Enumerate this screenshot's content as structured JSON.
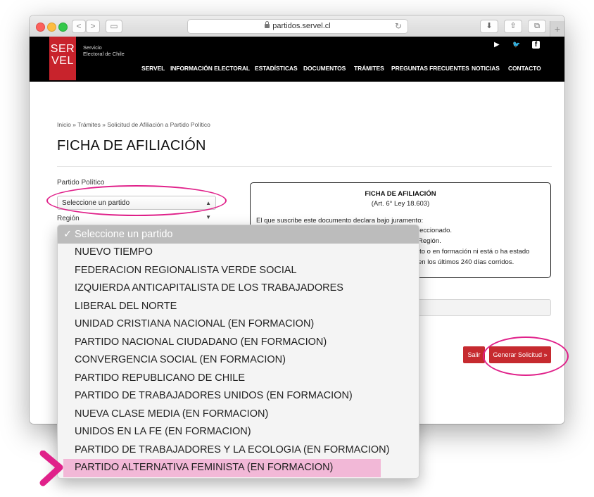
{
  "browser": {
    "url": "partidos.servel.cl",
    "back": "<",
    "forward": ">",
    "sidebar": "▭",
    "reload": "↻",
    "download": "⬇",
    "share": "⇧",
    "tabs": "⧉",
    "new_tab": "+"
  },
  "header": {
    "logo_line1": "SER",
    "logo_line2": "VEL",
    "brand_line1": "Servicio",
    "brand_line2": "Electoral de Chile",
    "social": {
      "youtube": "▶",
      "twitter": "🐦",
      "facebook": "f"
    },
    "nav": [
      "SERVEL",
      "INFORMACIÓN ELECTORAL",
      "ESTADÍSTICAS",
      "DOCUMENTOS",
      "TRÁMITES",
      "PREGUNTAS FRECUENTES",
      "NOTICIAS",
      "CONTACTO"
    ]
  },
  "breadcrumb": "Inicio  » Trámites  » Solicitud de Afiliación a Partido Político",
  "page_title": "FICHA DE AFILIACIÓN",
  "form": {
    "partido_label": "Partido Político",
    "partido_value": "Seleccione un partido",
    "region_label": "Región",
    "salir": "Salir",
    "generar": "Generar Solicitud »"
  },
  "ficha": {
    "title": "FICHA DE AFILIACIÓN",
    "subtitle": "(Art. 6° Ley 18.603)",
    "lines": [
      "El que suscribe este documento declara bajo juramento:",
      "leccionado.",
      "Región.",
      "ito o en formación ni está o ha estado",
      "en los últimos 240 días corridos."
    ]
  },
  "dropdown": {
    "check": "✓",
    "selected": "Seleccione un partido",
    "options": [
      "NUEVO TIEMPO",
      "FEDERACION REGIONALISTA VERDE SOCIAL",
      "IZQUIERDA ANTICAPITALISTA DE LOS TRABAJADORES",
      "LIBERAL DEL NORTE",
      "UNIDAD CRISTIANA NACIONAL (EN FORMACION)",
      "PARTIDO NACIONAL CIUDADANO (EN FORMACION)",
      "CONVERGENCIA SOCIAL (EN FORMACION)",
      "PARTIDO REPUBLICANO DE CHILE",
      "PARTIDO DE TRABAJADORES UNIDOS (EN FORMACION)",
      "NUEVA CLASE MEDIA (EN FORMACION)",
      "UNIDOS EN LA FE (EN FORMACION)",
      "PARTIDO DE TRABAJADORES Y LA ECOLOGIA (EN FORMACION)",
      "PARTIDO ALTERNATIVA FEMINISTA (EN FORMACION)"
    ]
  },
  "colors": {
    "accent": "#c62a2f",
    "annotation": "#e0218a",
    "highlight": "#f2b8d7"
  }
}
